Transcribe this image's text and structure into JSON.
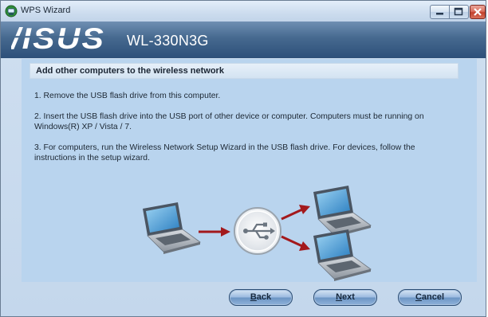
{
  "window": {
    "title": "WPS Wizard"
  },
  "header": {
    "brand": "ASUS",
    "model": "WL-330N3G"
  },
  "section": {
    "title": "Add other computers to the wireless network"
  },
  "instructions": [
    "1. Remove the USB flash drive from this computer.",
    "2. Insert the USB flash drive into the USB port of other device or computer. Computers must be running on Windows(R) XP / Vista / 7.",
    "3. For computers, run the Wireless Network Setup Wizard in the USB flash drive. For devices, follow the instructions in the setup wizard."
  ],
  "buttons": {
    "back": {
      "underline": "B",
      "rest": "ack"
    },
    "next": {
      "underline": "N",
      "rest": "ext"
    },
    "cancel": {
      "underline": "C",
      "rest": "ancel"
    }
  },
  "colors": {
    "header": "#46698f",
    "panel": "#b9d4ee",
    "arrow": "#a3191c"
  },
  "icons": {
    "title": "wps-wizard-icon",
    "illustration": [
      "laptop-icon",
      "arrow-right-icon",
      "usb-icon",
      "arrow-up-right-icon",
      "arrow-down-right-icon",
      "laptop-icon",
      "laptop-icon"
    ]
  }
}
